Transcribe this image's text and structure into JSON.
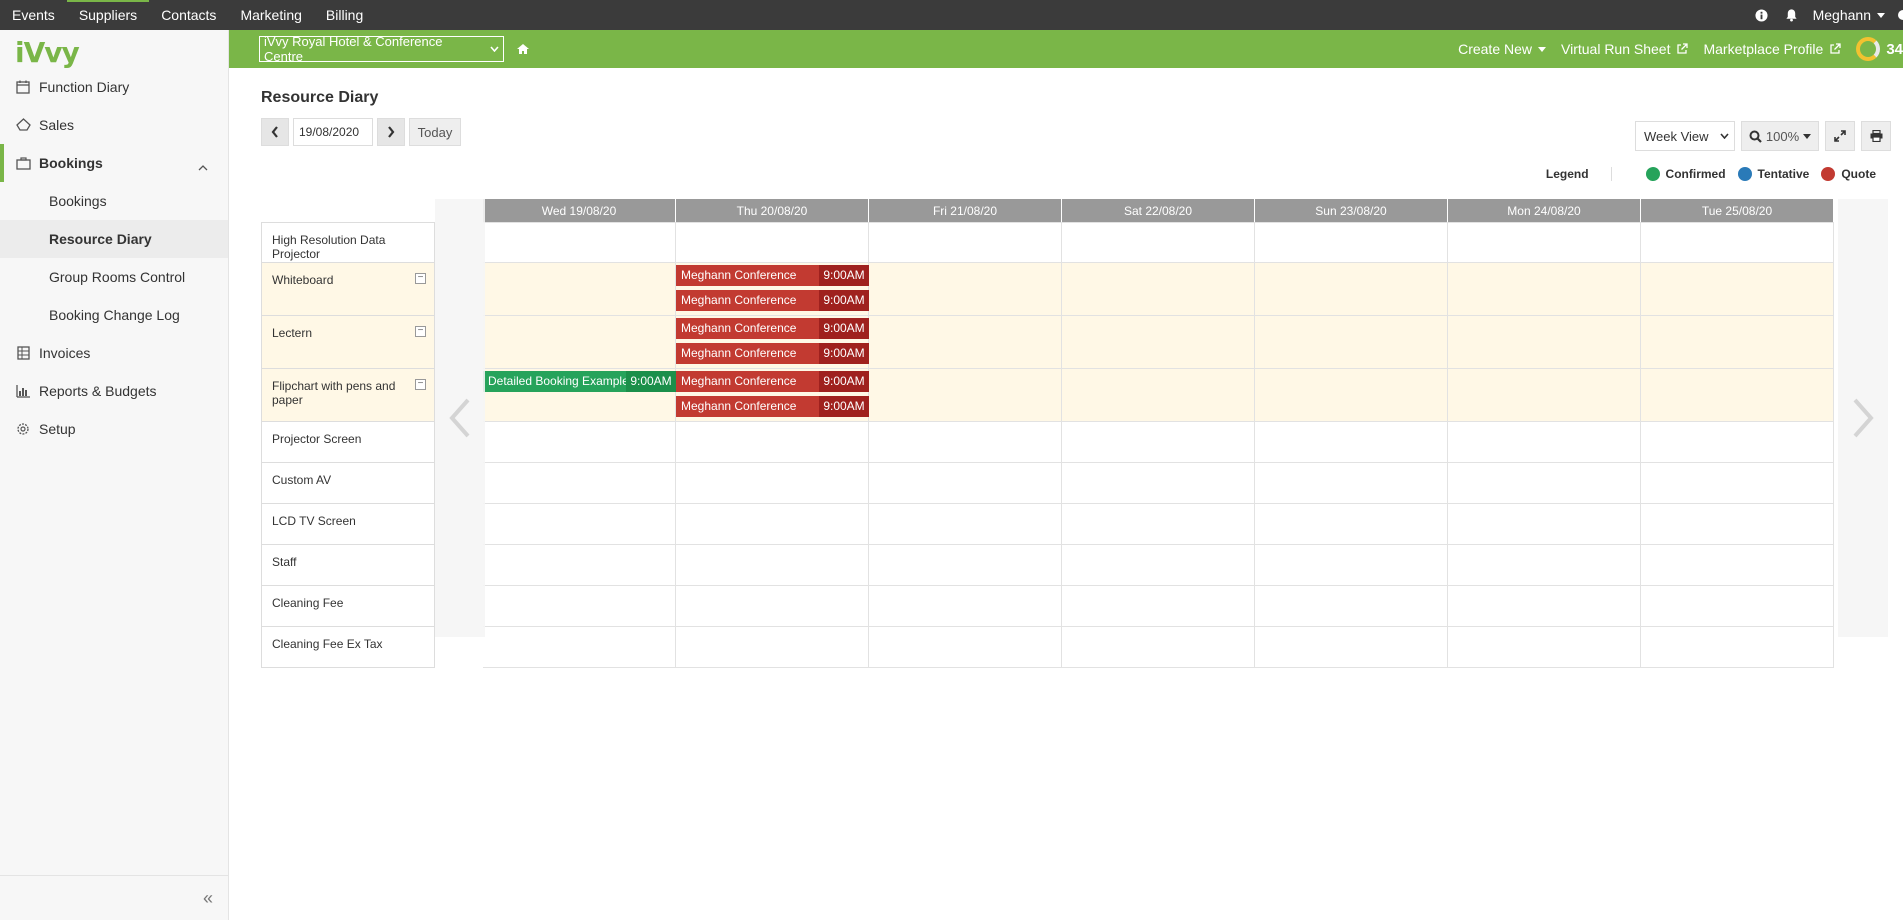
{
  "topnav": {
    "items": [
      "Events",
      "Suppliers",
      "Contacts",
      "Marketing",
      "Billing"
    ],
    "active": "Suppliers",
    "user": "Meghann"
  },
  "sidebar": {
    "logo": "iVvy",
    "items": [
      {
        "label": "Function Diary",
        "icon": "calendar-icon"
      },
      {
        "label": "Sales",
        "icon": "sales-icon"
      },
      {
        "label": "Bookings",
        "icon": "briefcase-icon"
      },
      {
        "label": "Invoices",
        "icon": "invoice-icon"
      },
      {
        "label": "Reports & Budgets",
        "icon": "chart-icon"
      },
      {
        "label": "Setup",
        "icon": "gear-icon"
      }
    ],
    "sub_items": [
      "Bookings",
      "Resource Diary",
      "Group Rooms Control",
      "Booking Change Log"
    ],
    "active_sub": "Resource Diary"
  },
  "greenbar": {
    "venue": "iVvy Royal Hotel & Conference Centre",
    "create_new": "Create New",
    "virtual_run_sheet": "Virtual Run Sheet",
    "marketplace_profile": "Marketplace Profile",
    "score": "34"
  },
  "main": {
    "title": "Resource Diary",
    "date": "19/08/2020",
    "today_label": "Today",
    "view": "Week View",
    "zoom": "100%"
  },
  "legend": {
    "title": "Legend",
    "items": [
      {
        "label": "Confirmed",
        "color": "#26a35b"
      },
      {
        "label": "Tentative",
        "color": "#2a7ab8"
      },
      {
        "label": "Quote",
        "color": "#c23a31"
      }
    ]
  },
  "diary": {
    "days": [
      "Wed 19/08/20",
      "Thu 20/08/20",
      "Fri 21/08/20",
      "Sat 22/08/20",
      "Sun 23/08/20",
      "Mon 24/08/20",
      "Tue 25/08/20"
    ],
    "resources": [
      "High Resolution Data Projector",
      "Whiteboard",
      "Lectern",
      "Flipchart with pens and paper",
      "Projector Screen",
      "Custom AV",
      "LCD TV Screen",
      "Staff",
      "Cleaning Fee",
      "Cleaning Fee Ex Tax"
    ],
    "bookings": [
      {
        "resource": 1,
        "day": 1,
        "name": "Meghann Conference",
        "time": "9:00AM",
        "status": "Quote",
        "slot": 0
      },
      {
        "resource": 1,
        "day": 1,
        "name": "Meghann Conference",
        "time": "9:00AM",
        "status": "Quote",
        "slot": 1
      },
      {
        "resource": 2,
        "day": 1,
        "name": "Meghann Conference",
        "time": "9:00AM",
        "status": "Quote",
        "slot": 0
      },
      {
        "resource": 2,
        "day": 1,
        "name": "Meghann Conference",
        "time": "9:00AM",
        "status": "Quote",
        "slot": 1
      },
      {
        "resource": 3,
        "day": 0,
        "name": "Detailed Booking Example",
        "time": "9:00AM",
        "status": "Confirmed",
        "slot": 0
      },
      {
        "resource": 3,
        "day": 1,
        "name": "Meghann Conference",
        "time": "9:00AM",
        "status": "Quote",
        "slot": 0
      },
      {
        "resource": 3,
        "day": 1,
        "name": "Meghann Conference",
        "time": "9:00AM",
        "status": "Quote",
        "slot": 1
      }
    ]
  }
}
